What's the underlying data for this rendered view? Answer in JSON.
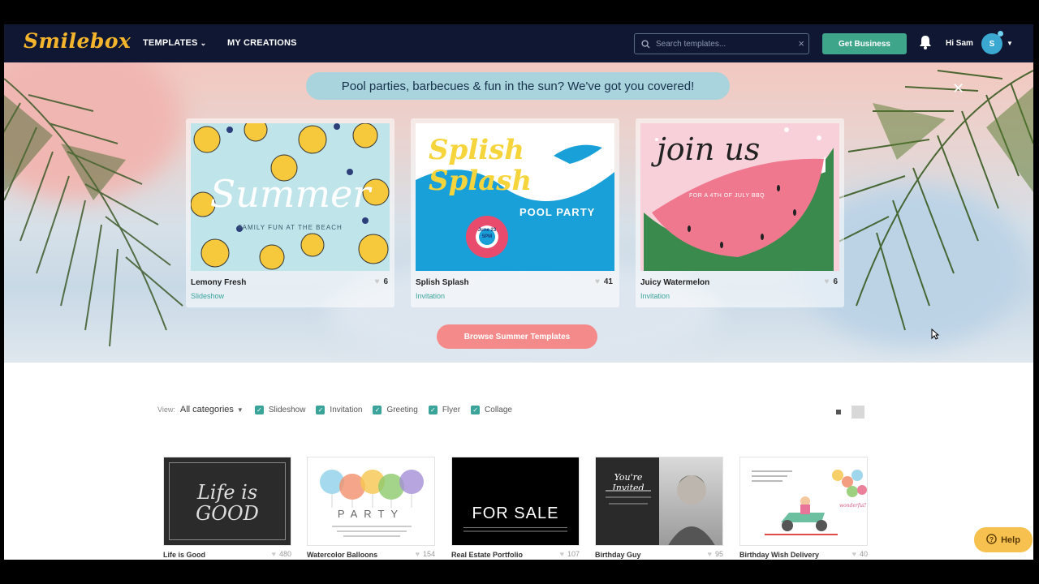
{
  "header": {
    "logo": "Smilebox",
    "nav": [
      {
        "label": "TEMPLATES"
      },
      {
        "label": "MY CREATIONS"
      }
    ],
    "search": {
      "placeholder": "Search templates...",
      "value": ""
    },
    "business_button": "Get Business",
    "greeting": "Hi Sam",
    "avatar_initial": "S"
  },
  "hero": {
    "banner": "Pool parties, barbecues & fun in the sun? We've got you covered!",
    "browse_button": "Browse Summer Templates",
    "cards": [
      {
        "name": "Lemony Fresh",
        "type": "Slideshow",
        "likes": "6",
        "art_title": "Summer",
        "art_sub": "FAMILY FUN AT THE BEACH"
      },
      {
        "name": "Splish Splash",
        "type": "Invitation",
        "likes": "41",
        "art_title": "Splish Splash",
        "art_sub": "POOL PARTY",
        "art_date": "June 23 5PM"
      },
      {
        "name": "Juicy Watermelon",
        "type": "Invitation",
        "likes": "6",
        "art_title": "join us",
        "art_sub": "FOR A 4TH OF JULY BBQ"
      }
    ]
  },
  "filters": {
    "view_label": "View:",
    "category": "All categories",
    "options": [
      {
        "label": "Slideshow",
        "checked": true
      },
      {
        "label": "Invitation",
        "checked": true
      },
      {
        "label": "Greeting",
        "checked": true
      },
      {
        "label": "Flyer",
        "checked": true
      },
      {
        "label": "Collage",
        "checked": true
      }
    ]
  },
  "templates": [
    {
      "name": "Life is Good",
      "likes": "480",
      "art_text": "Life is GOOD"
    },
    {
      "name": "Watercolor Balloons",
      "likes": "154",
      "art_text": "PARTY"
    },
    {
      "name": "Real Estate Portfolio",
      "likes": "107",
      "art_text": "FOR SALE"
    },
    {
      "name": "Birthday Guy",
      "likes": "95",
      "art_text": "You're Invited"
    },
    {
      "name": "Birthday Wish Delivery",
      "likes": "40",
      "art_text": "wonderful!"
    }
  ],
  "help_button": "Help",
  "colors": {
    "nav_bg": "#0f1733",
    "accent_green": "#3fa58a",
    "teal": "#3aa39a",
    "browse_pink": "#f48a8a",
    "help_yellow": "#f6c14f"
  }
}
